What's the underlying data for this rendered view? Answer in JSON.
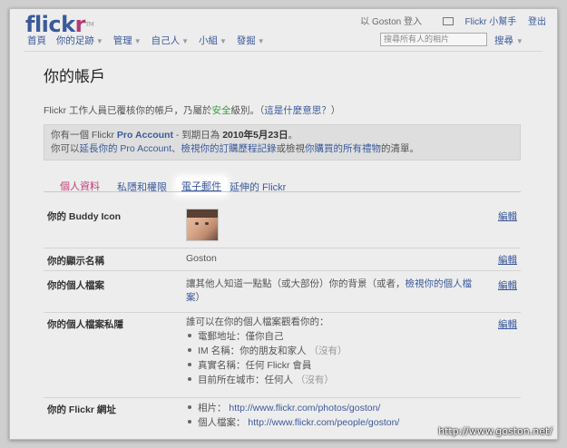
{
  "header": {
    "logo_part1": "flick",
    "logo_part2": "r",
    "logo_tm": "TM",
    "logged_in_as": "以 Goston 登入",
    "helper": "Flickr 小幫手",
    "logout": "登出"
  },
  "nav": {
    "items": [
      "首頁",
      "你的足跡",
      "管理",
      "自己人",
      "小組",
      "發掘"
    ],
    "search_placeholder": "搜尋所有人的相片",
    "search_label": "搜尋"
  },
  "page": {
    "title": "你的帳戶",
    "verify_pre": "Flickr 工作人員已覆核你的帳戶，乃屬於",
    "verify_level": "安全",
    "verify_post": "級別。（",
    "verify_link": "這是什麼意思？",
    "verify_end": "）"
  },
  "probox": {
    "l1_pre": "你有一個 Flickr ",
    "l1_link": "Pro Account",
    "l1_mid": " - 到期日為 ",
    "l1_date": "2010年5月23日",
    "l1_end": "。",
    "l2_pre": "你可以",
    "l2_link1": "延長你的 Pro Account",
    "l2_sep": "、",
    "l2_link2": "檢視你的訂購歷程記錄",
    "l2_mid": "或檢視",
    "l2_link3": "你購買的所有禮物",
    "l2_end": "的清單。"
  },
  "tabs": [
    "個人資料",
    "私隱和權限",
    "電子郵件",
    "延伸的 Flickr"
  ],
  "rows": {
    "buddy": {
      "label": "你的 Buddy Icon",
      "edit": "編輯"
    },
    "display": {
      "label": "你的顯示名稱",
      "value": "Goston",
      "edit": "編輯"
    },
    "profile": {
      "label": "你的個人檔案",
      "value_pre": "讓其他人知道一點點（或大部份）你的背景（或者，",
      "value_link": "檢視你的個人檔案",
      "value_end": "）",
      "edit": "編輯"
    },
    "privacy": {
      "label": "你的個人檔案私隱",
      "intro": "誰可以在你的個人檔案觀看你的：",
      "items": [
        {
          "text": "電郵地址：僅你自己",
          "note": ""
        },
        {
          "text": "IM 名稱：你的朋友和家人",
          "note": "（沒有）"
        },
        {
          "text": "真實名稱：任何 Flickr 會員",
          "note": ""
        },
        {
          "text": "目前所在城市：任何人",
          "note": "（沒有）"
        }
      ],
      "edit": "編輯"
    },
    "urls": {
      "label": "你的 Flickr 網址",
      "photos_label": "相片：",
      "photos_url": "http://www.flickr.com/photos/goston/",
      "profile_label": "個人檔案：",
      "profile_url": "http://www.flickr.com/people/goston/"
    }
  },
  "watermark": "http://www.goston.net/"
}
